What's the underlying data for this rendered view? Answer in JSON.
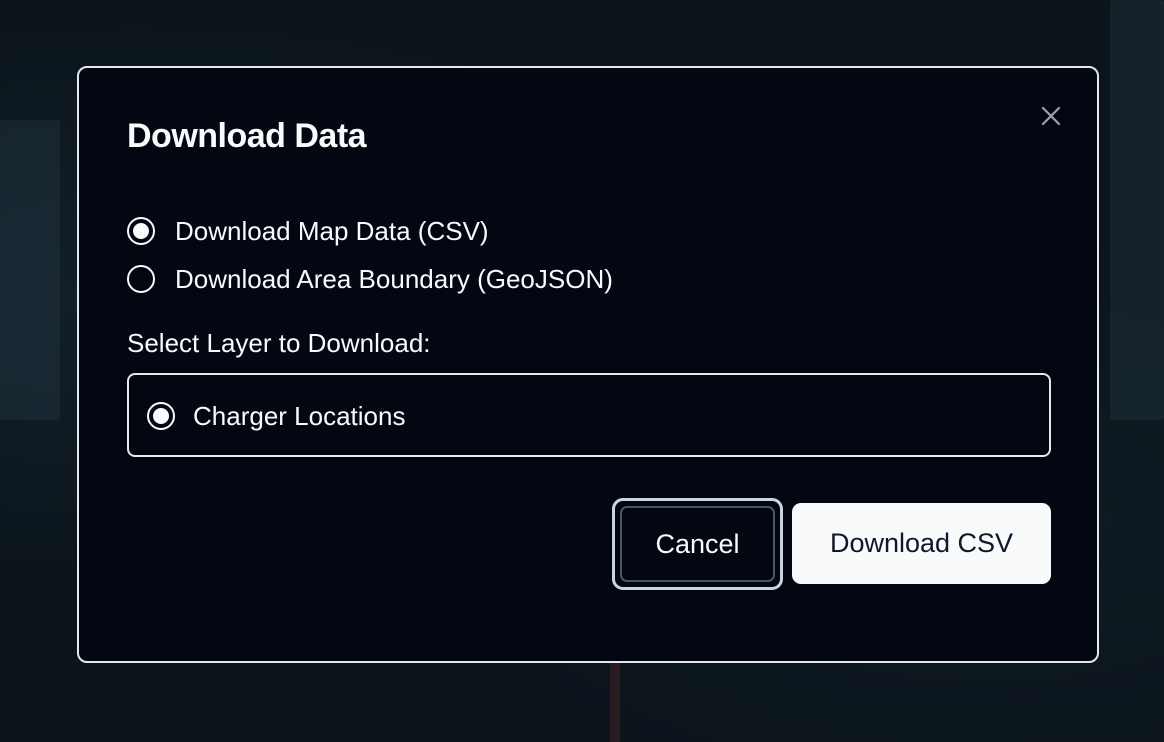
{
  "dialog": {
    "title": "Download Data",
    "close_icon": "close-icon",
    "format_options": [
      {
        "label": "Download Map Data (CSV)",
        "selected": true
      },
      {
        "label": "Download Area Boundary (GeoJSON)",
        "selected": false
      }
    ],
    "layer_section_label": "Select Layer to Download:",
    "layers": [
      {
        "label": "Charger Locations",
        "selected": true
      }
    ],
    "buttons": {
      "cancel": "Cancel",
      "download": "Download CSV"
    }
  },
  "colors": {
    "dialog_bg": "#020712",
    "text": "#f8fafc",
    "border": "#e5e7eb",
    "primary_button_bg": "#f8fafc",
    "primary_button_text": "#0f172a"
  }
}
